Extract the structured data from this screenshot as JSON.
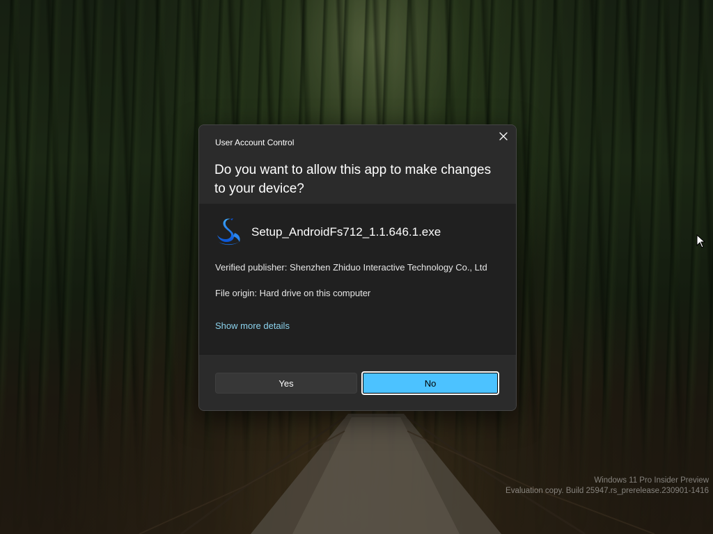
{
  "dialog": {
    "title": "User Account Control",
    "question": "Do you want to allow this app to make changes to your device?",
    "app_name": "Setup_AndroidFs712_1.1.646.1.exe",
    "publisher_line": "Verified publisher: Shenzhen Zhiduo Interactive Technology Co., Ltd",
    "origin_line": "File origin: Hard drive on this computer",
    "more_details_link": "Show more details",
    "yes_label": "Yes",
    "no_label": "No",
    "close_icon": "close-icon",
    "app_icon": "swan-icon"
  },
  "desktop": {
    "watermark_line1": "Windows 11 Pro Insider Preview",
    "watermark_line2": "Evaluation copy. Build 25947.rs_prerelease.230901-1416"
  },
  "colors": {
    "accent": "#4cc2ff",
    "link": "#8cd3ee",
    "dialog_bg": "#2b2b2b",
    "dialog_body_bg": "#202020"
  }
}
